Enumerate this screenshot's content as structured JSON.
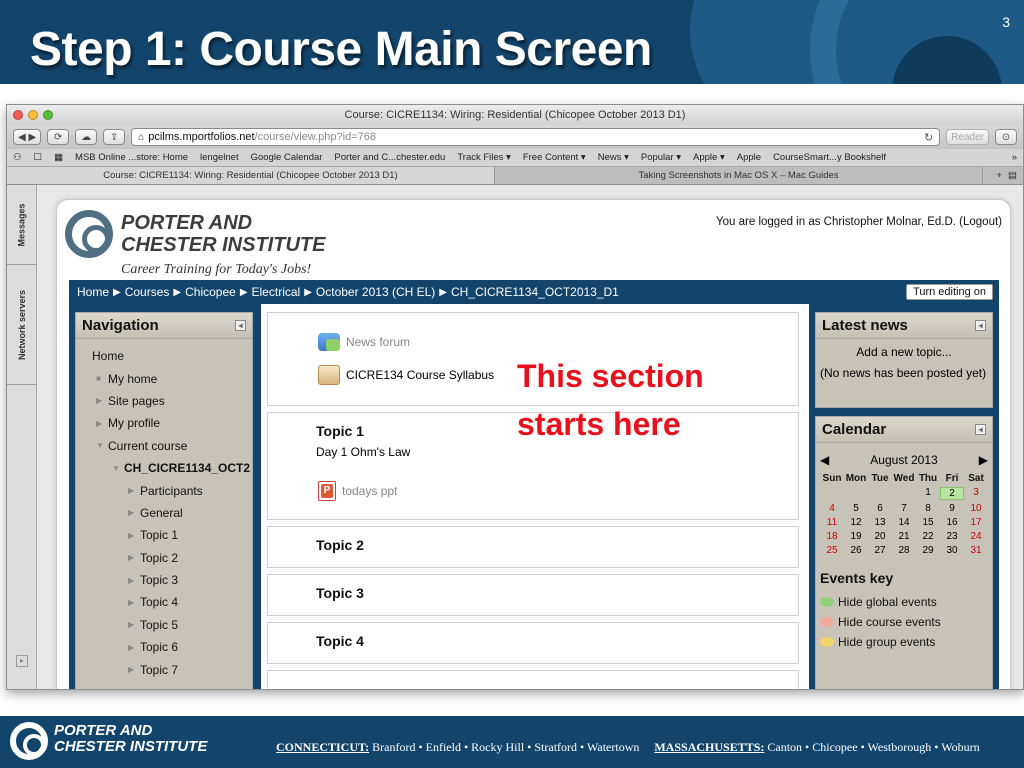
{
  "slide": {
    "title": "Step 1: Course Main Screen",
    "number": "3",
    "annotation_line1": "This section",
    "annotation_line2": "starts here"
  },
  "browser": {
    "window_title": "Course: CICRE1134: Wiring: Residential (Chicopee October 2013 D1)",
    "url_host": "pcilms.mportfolios.net",
    "url_path": "/course/view.php?id=768",
    "reader_label": "Reader",
    "bookmarks": [
      "MSB Online ...store: Home",
      "lengelnet",
      "Google Calendar",
      "Porter and C...chester.edu",
      "Track Files ▾",
      "Free Content ▾",
      "News ▾",
      "Popular ▾",
      "Apple ▾",
      "Apple",
      "CourseSmart...y Bookshelf"
    ],
    "tabs": [
      "Course: CICRE1134: Wiring: Residential (Chicopee October 2013 D1)",
      "Taking Screenshots in Mac OS X – Mac Guides"
    ],
    "side_tabs": [
      "Messages",
      "Network servers"
    ]
  },
  "moodle": {
    "logo_line1": "PORTER AND",
    "logo_line2": "CHESTER INSTITUTE",
    "logo_tagline": "Career Training for Today's Jobs!",
    "logged_in": "You are logged in as Christopher Molnar, Ed.D. (Logout)",
    "breadcrumb": [
      "Home",
      "Courses",
      "Chicopee",
      "Electrical",
      "October 2013 (CH EL)",
      "CH_CICRE1134_OCT2013_D1"
    ],
    "turn_editing": "Turn editing on",
    "navigation": {
      "title": "Navigation",
      "items": [
        {
          "label": "Home",
          "indent": 0,
          "arrow": ""
        },
        {
          "label": "My home",
          "indent": 1,
          "arrow": "■"
        },
        {
          "label": "Site pages",
          "indent": 1,
          "arrow": "▶"
        },
        {
          "label": "My profile",
          "indent": 1,
          "arrow": "▶"
        },
        {
          "label": "Current course",
          "indent": 1,
          "arrow": "▼"
        },
        {
          "label": "CH_CICRE1134_OCT2",
          "indent": 2,
          "arrow": "▼",
          "bold": true
        },
        {
          "label": "Participants",
          "indent": 3,
          "arrow": "▶"
        },
        {
          "label": "General",
          "indent": 3,
          "arrow": "▶"
        },
        {
          "label": "Topic 1",
          "indent": 3,
          "arrow": "▶"
        },
        {
          "label": "Topic 2",
          "indent": 3,
          "arrow": "▶"
        },
        {
          "label": "Topic 3",
          "indent": 3,
          "arrow": "▶"
        },
        {
          "label": "Topic 4",
          "indent": 3,
          "arrow": "▶"
        },
        {
          "label": "Topic 5",
          "indent": 3,
          "arrow": "▶"
        },
        {
          "label": "Topic 6",
          "indent": 3,
          "arrow": "▶"
        },
        {
          "label": "Topic 7",
          "indent": 3,
          "arrow": "▶"
        }
      ]
    },
    "sections": {
      "news_forum": "News forum",
      "syllabus": "CICRE134 Course Syllabus",
      "topic1_title": "Topic 1",
      "topic1_summary": "Day 1 Ohm's Law",
      "topic1_file": "todays ppt",
      "topic2_title": "Topic 2",
      "topic3_title": "Topic 3",
      "topic4_title": "Topic 4"
    },
    "latest_news": {
      "title": "Latest news",
      "add_topic": "Add a new topic...",
      "empty": "(No news has been posted yet)"
    },
    "calendar": {
      "title": "Calendar",
      "month": "August 2013",
      "day_headers": [
        "Sun",
        "Mon",
        "Tue",
        "Wed",
        "Thu",
        "Fri",
        "Sat"
      ],
      "weeks": [
        [
          "",
          "",
          "",
          "",
          "1",
          "2",
          "3"
        ],
        [
          "4",
          "5",
          "6",
          "7",
          "8",
          "9",
          "10"
        ],
        [
          "11",
          "12",
          "13",
          "14",
          "15",
          "16",
          "17"
        ],
        [
          "18",
          "19",
          "20",
          "21",
          "22",
          "23",
          "24"
        ],
        [
          "25",
          "26",
          "27",
          "28",
          "29",
          "30",
          "31"
        ]
      ],
      "today": "2"
    },
    "events_key": {
      "title": "Events key",
      "items": [
        {
          "label": "Hide global events",
          "color": "#8fd07a"
        },
        {
          "label": "Hide course events",
          "color": "#f2a9a0"
        },
        {
          "label": "Hide group events",
          "color": "#f3d36a"
        }
      ]
    }
  },
  "footer": {
    "logo_line1": "PORTER AND",
    "logo_line2": "CHESTER INSTITUTE",
    "state1": "CONNECTICUT:",
    "state1_towns": "Branford • Enfield • Rocky Hill • Stratford • Watertown",
    "state2": "MASSACHUSETTS:",
    "state2_towns": "Canton • Chicopee • Westborough • Woburn"
  },
  "colors": {
    "brand_navy": "#13456c",
    "annotation_red": "#e8101c",
    "block_tan": "#c8c3b8"
  }
}
